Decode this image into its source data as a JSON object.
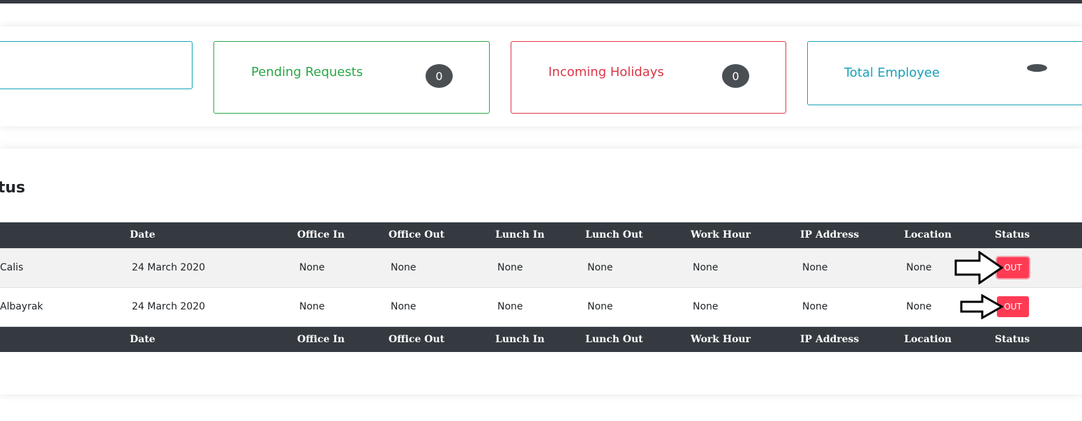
{
  "stats": {
    "pending": {
      "label": "Pending Requests",
      "count": "0"
    },
    "holidays": {
      "label": "Incoming Holidays",
      "count": "0"
    },
    "total": {
      "label": "Total Employee"
    }
  },
  "status_section": {
    "title": "atus",
    "columns": [
      "",
      "Date",
      "Office In",
      "Office Out",
      "Lunch In",
      "Lunch Out",
      "Work Hour",
      "IP Address",
      "Location",
      "Status"
    ],
    "rows": [
      {
        "name": "Calis",
        "date": "24 March 2020",
        "office_in": "None",
        "office_out": "None",
        "lunch_in": "None",
        "lunch_out": "None",
        "work_hour": "None",
        "ip": "None",
        "location": "None",
        "status": "OUT"
      },
      {
        "name": "Albayrak",
        "date": "24 March 2020",
        "office_in": "None",
        "office_out": "None",
        "lunch_in": "None",
        "lunch_out": "None",
        "work_hour": "None",
        "ip": "None",
        "location": "None",
        "status": "OUT"
      }
    ]
  },
  "colors": {
    "pending": "#28a745",
    "holidays": "#dc3545",
    "total": "#17a2b8",
    "out_button": "#ff3b54",
    "header_dark": "#343a40"
  },
  "icons": {
    "status_pointer": "arrow-right-outline-icon"
  }
}
